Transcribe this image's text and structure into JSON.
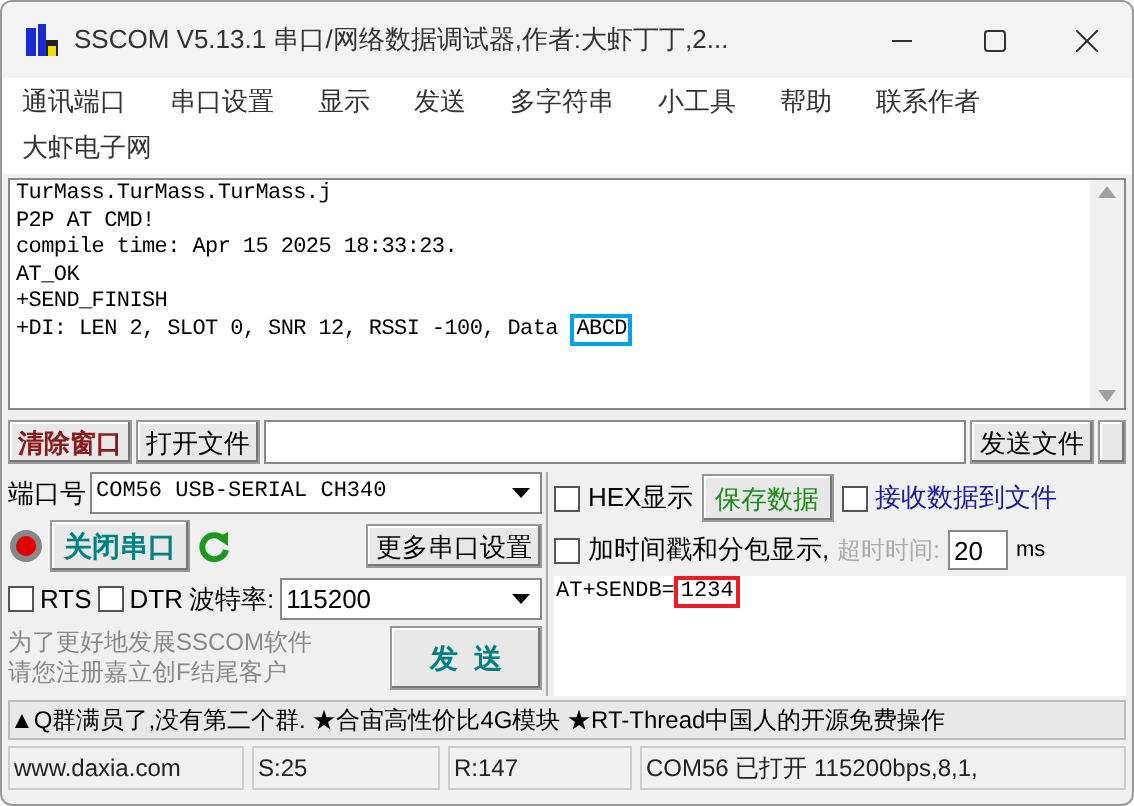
{
  "window": {
    "title": "SSCOM V5.13.1 串口/网络数据调试器,作者:大虾丁丁,2..."
  },
  "menu": [
    "通讯端口",
    "串口设置",
    "显示",
    "发送",
    "多字符串",
    "小工具",
    "帮助",
    "联系作者",
    "大虾电子网"
  ],
  "receive_log": [
    {
      "text": "TurMass.TurMass.TurMass.j"
    },
    {
      "text": "P2P AT CMD!"
    },
    {
      "text": "compile time: Apr 15 2025 18:33:23."
    },
    {
      "text": "AT_OK"
    },
    {
      "text": "+SEND_FINISH"
    },
    {
      "text": "+DI: LEN 2, SLOT 0, SNR 12, RSSI -100, Data ",
      "highlight": "ABCD",
      "color": "#00a2e8"
    }
  ],
  "file_bar": {
    "clear_button": "清除窗口",
    "open_file_button": "打开文件",
    "send_file_button": "发送文件"
  },
  "port": {
    "label": "端口号",
    "value": "COM56 USB-SERIAL CH340",
    "close_button": "关闭串口",
    "more_settings_button": "更多串口设置",
    "open": true,
    "rts": {
      "label": "RTS",
      "checked": false
    },
    "dtr": {
      "label": "DTR",
      "checked": false
    },
    "baud_label": "波特率:",
    "baud_value": "115200"
  },
  "promo": [
    "为了更好地发展SSCOM软件",
    "请您注册嘉立创F结尾客户"
  ],
  "send_button": "发  送",
  "options": {
    "hex_display": {
      "label": "HEX显示",
      "checked": false
    },
    "save_button": "保存数据",
    "receive_to_file": {
      "label": "接收数据到文件",
      "checked": false
    },
    "timestamp": {
      "label": "加时间戳和分包显示,",
      "checked": false
    },
    "timeout_label": "超时时间:",
    "timeout_value": "20",
    "timeout_unit": "ms"
  },
  "send_input": {
    "value": "AT+SENDB=",
    "highlight": "1234",
    "color": "#ed1c24"
  },
  "ticker": "▲Q群满员了,没有第二个群. ★合宙高性价比4G模块 ★RT-Thread中国人的开源免费操作",
  "status_bar": [
    "www.daxia.com",
    "S:25",
    "R:147",
    "COM56 已打开  115200bps,8,1,"
  ]
}
